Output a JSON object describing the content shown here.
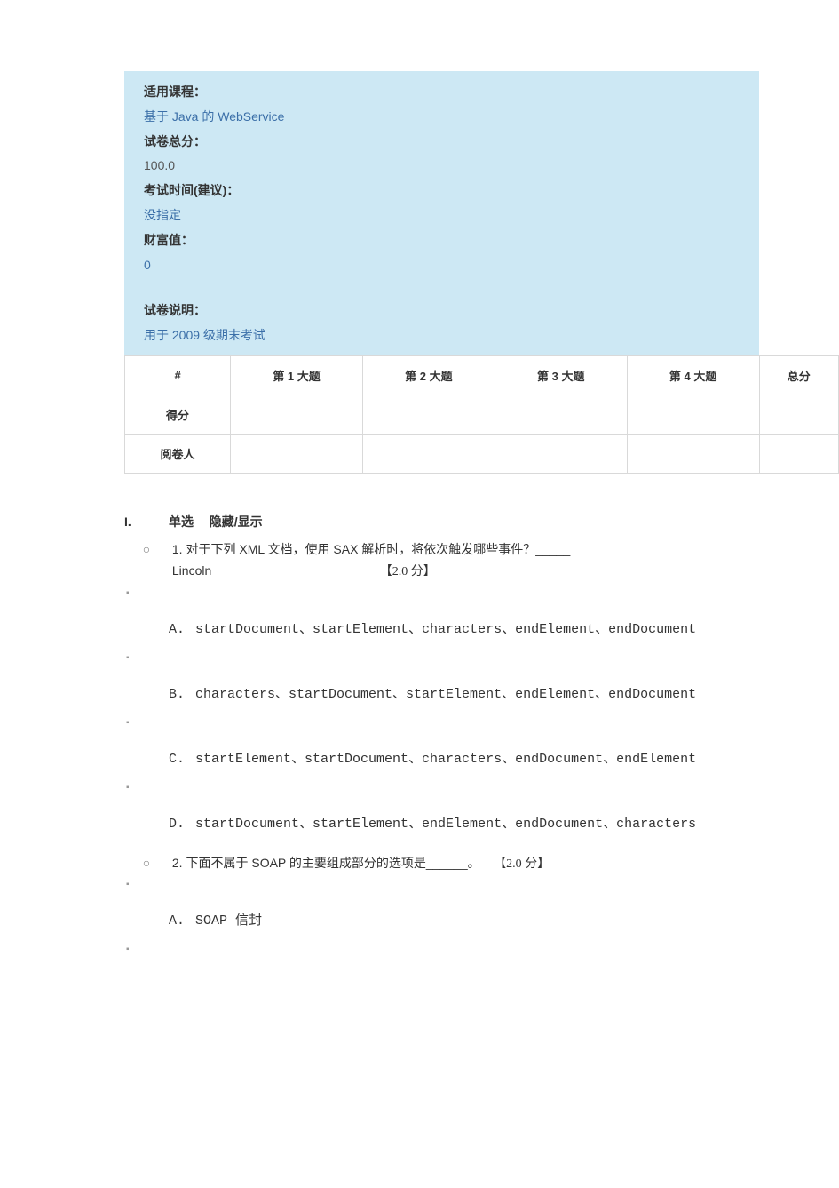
{
  "info": {
    "course_label": "适用课程：",
    "course_value": "基于 Java 的 WebService",
    "total_label": "试卷总分：",
    "total_value": "100.0",
    "time_label": "考试时间(建议)：",
    "time_value": "没指定",
    "wealth_label": "财富值：",
    "wealth_value": "0",
    "desc_label": "试卷说明：",
    "desc_value": "用于 2009 级期末考试"
  },
  "score_table": {
    "hash": "#",
    "cols": [
      "第 1 大题",
      "第 2 大题",
      "第 3 大题",
      "第 4 大题"
    ],
    "total_col": "总分",
    "row_score": "得分",
    "row_grader": "阅卷人"
  },
  "section1": {
    "numeral": "I.",
    "type": "单选",
    "toggle": "隐藏/显示"
  },
  "q1": {
    "marker": "○",
    "num": "1.",
    "text_line1": "对于下列 XML 文档，使用 SAX 解析时，将依次触发哪些事件？_____",
    "text_line2_left": "Lincoln",
    "score": "【2.0 分】",
    "opt_bullet": "▪",
    "options": [
      {
        "label": "A.",
        "text": "startDocument、startElement、characters、endElement、endDocument"
      },
      {
        "label": "B.",
        "text": "characters、startDocument、startElement、endElement、endDocument"
      },
      {
        "label": "C.",
        "text": "startElement、startDocument、characters、endDocument、endElement"
      },
      {
        "label": "D.",
        "text": "startDocument、startElement、endElement、endDocument、characters"
      }
    ]
  },
  "q2": {
    "marker": "○",
    "num": "2.",
    "text": "下面不属于 SOAP 的主要组成部分的选项是______。",
    "score": "【2.0 分】",
    "opt_bullet": "▪",
    "options": [
      {
        "label": "A.",
        "text": "SOAP 信封"
      }
    ]
  }
}
